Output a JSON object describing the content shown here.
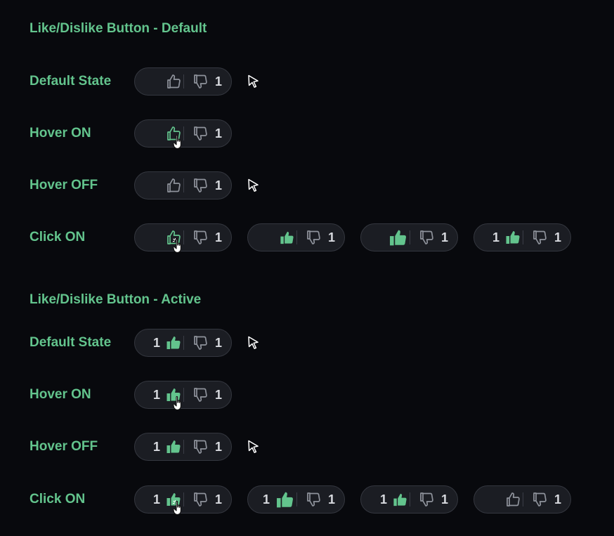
{
  "sections": [
    {
      "title": "Like/Dislike Button - Default",
      "rows": [
        {
          "label": "Default State",
          "buttons": [
            {
              "like_count": "",
              "like_state": "outline-gray",
              "dislike_count": "1",
              "cursor": "arrow"
            }
          ]
        },
        {
          "label": "Hover ON",
          "buttons": [
            {
              "like_count": "",
              "like_state": "outline-green",
              "dislike_count": "1",
              "cursor": "hand"
            }
          ]
        },
        {
          "label": "Hover OFF",
          "buttons": [
            {
              "like_count": "",
              "like_state": "outline-gray",
              "dislike_count": "1",
              "cursor": "arrow"
            }
          ]
        },
        {
          "label": "Click ON",
          "buttons": [
            {
              "like_count": "",
              "like_state": "outline-green",
              "dislike_count": "1",
              "cursor": "hand-click"
            },
            {
              "like_count": "",
              "like_state": "filled-green-small",
              "dislike_count": "1",
              "cursor": ""
            },
            {
              "like_count": "",
              "like_state": "filled-green-large",
              "dislike_count": "1",
              "cursor": ""
            },
            {
              "like_count": "1",
              "like_state": "filled-green",
              "dislike_count": "1",
              "cursor": ""
            }
          ]
        }
      ]
    },
    {
      "title": "Like/Dislike Button - Active",
      "rows": [
        {
          "label": "Default State",
          "buttons": [
            {
              "like_count": "1",
              "like_state": "filled-green",
              "dislike_count": "1",
              "cursor": "arrow"
            }
          ]
        },
        {
          "label": "Hover ON",
          "buttons": [
            {
              "like_count": "1",
              "like_state": "filled-green",
              "dislike_count": "1",
              "cursor": "hand"
            }
          ]
        },
        {
          "label": "Hover OFF",
          "buttons": [
            {
              "like_count": "1",
              "like_state": "filled-green",
              "dislike_count": "1",
              "cursor": "arrow"
            }
          ]
        },
        {
          "label": "Click ON",
          "buttons": [
            {
              "like_count": "1",
              "like_state": "filled-green",
              "dislike_count": "1",
              "cursor": "hand-click"
            },
            {
              "like_count": "1",
              "like_state": "filled-green-large",
              "dislike_count": "1",
              "cursor": ""
            },
            {
              "like_count": "1",
              "like_state": "filled-green-small",
              "dislike_count": "1",
              "cursor": ""
            },
            {
              "like_count": "",
              "like_state": "outline-gray",
              "dislike_count": "1",
              "cursor": ""
            }
          ]
        }
      ]
    }
  ],
  "icons": {
    "like": "thumbs-up-icon",
    "dislike": "thumbs-down-icon",
    "pointer": "pointer-arrow-icon",
    "hand": "hand-cursor-icon"
  },
  "colors": {
    "background": "#08090d",
    "accent": "#63c48d",
    "pill_bg": "#1b1d23",
    "pill_border": "#34373f",
    "icon_gray": "#8f939c",
    "count_text": "#d7d9de"
  }
}
